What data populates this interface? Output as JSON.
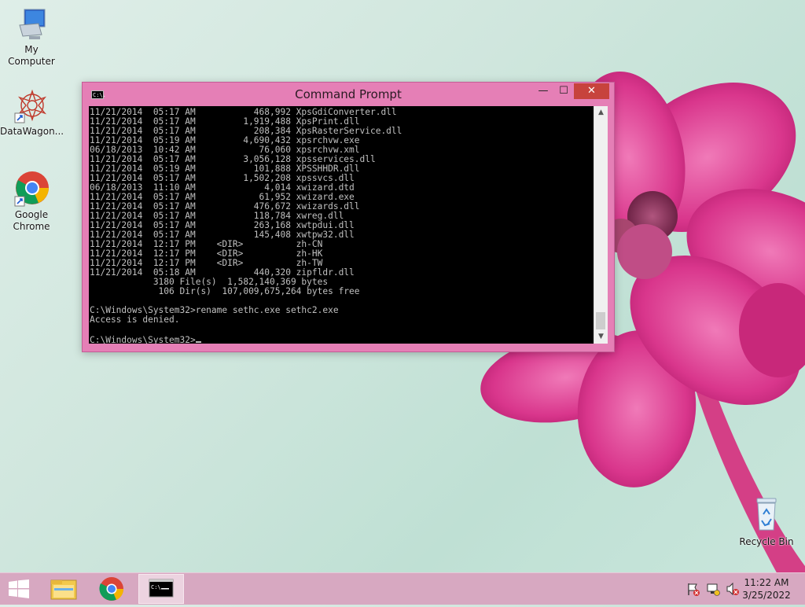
{
  "desktop": {
    "icons": [
      {
        "label": "My Computer",
        "icon": "computer-icon"
      },
      {
        "label": "DataWagon...",
        "icon": "datawagon-icon"
      },
      {
        "label": "Google Chrome",
        "icon": "chrome-icon"
      },
      {
        "label": "Recycle Bin",
        "icon": "recycle-bin-icon"
      }
    ]
  },
  "window": {
    "title": "Command Prompt",
    "icon_text": "C:\\.",
    "controls": {
      "minimize": "—",
      "maximize": "☐",
      "close": "✕"
    }
  },
  "console": {
    "lines": [
      "11/21/2014  05:17 AM           468,992 XpsGdiConverter.dll",
      "11/21/2014  05:17 AM         1,919,488 XpsPrint.dll",
      "11/21/2014  05:17 AM           208,384 XpsRasterService.dll",
      "11/21/2014  05:19 AM         4,690,432 xpsrchvw.exe",
      "06/18/2013  10:42 AM            76,060 xpsrchvw.xml",
      "11/21/2014  05:17 AM         3,056,128 xpsservices.dll",
      "11/21/2014  05:19 AM           101,888 XPSSHHDR.dll",
      "11/21/2014  05:17 AM         1,502,208 xpssvcs.dll",
      "06/18/2013  11:10 AM             4,014 xwizard.dtd",
      "11/21/2014  05:17 AM            61,952 xwizard.exe",
      "11/21/2014  05:17 AM           476,672 xwizards.dll",
      "11/21/2014  05:17 AM           118,784 xwreg.dll",
      "11/21/2014  05:17 AM           263,168 xwtpdui.dll",
      "11/21/2014  05:17 AM           145,408 xwtpw32.dll",
      "11/21/2014  12:17 PM    <DIR>          zh-CN",
      "11/21/2014  12:17 PM    <DIR>          zh-HK",
      "11/21/2014  12:17 PM    <DIR>          zh-TW",
      "11/21/2014  05:18 AM           440,320 zipfldr.dll",
      "            3180 File(s)  1,582,140,369 bytes",
      "             106 Dir(s)  107,009,675,264 bytes free",
      "",
      "C:\\Windows\\System32>rename sethc.exe sethc2.exe",
      "Access is denied.",
      ""
    ],
    "prompt": "C:\\Windows\\System32>"
  },
  "taskbar": {
    "items": [
      {
        "name": "file-explorer",
        "icon": "folder-icon"
      },
      {
        "name": "chrome",
        "icon": "chrome-icon"
      },
      {
        "name": "command-prompt",
        "icon": "cmd-icon",
        "active": true
      }
    ],
    "clock": {
      "time": "11:22 AM",
      "date": "3/25/2022"
    }
  },
  "colors": {
    "window_frame": "#e57fb6",
    "close_button": "#c7433d",
    "console_bg": "#000000",
    "console_text": "#c0c0c0",
    "taskbar": "#d7a8c1"
  }
}
